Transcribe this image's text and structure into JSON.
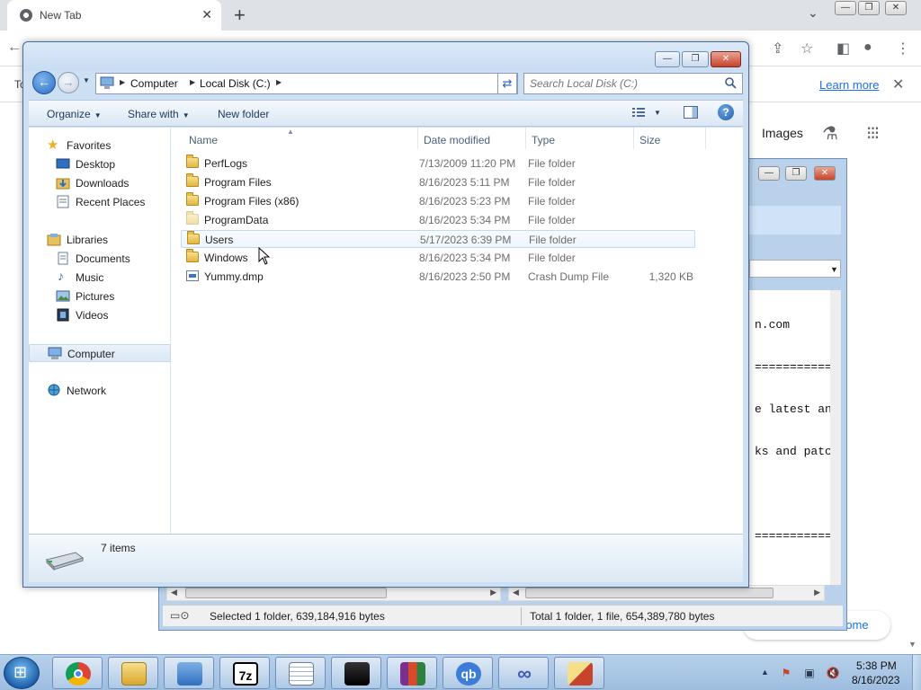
{
  "chrome": {
    "tab_title": "New Tab",
    "tab_close": "✕",
    "new_tab": "+",
    "tab_search": "⌄",
    "window_buttons": [
      "—",
      "❐",
      "✕"
    ],
    "infobar_text": "To",
    "infobar_link": "Learn more",
    "infobar_close": "✕",
    "images_link": "Images",
    "customize_label": "rome",
    "toolbar_icons": [
      "share-icon",
      "star-icon",
      "side-panel-icon",
      "profile-icon",
      "menu-icon"
    ]
  },
  "zip": {
    "window_buttons": [
      "—",
      "❐",
      "✕"
    ],
    "content_lines": [
      "n.com",
      "==============",
      "e latest an",
      "ks and patc",
      "",
      "==============",
      "",
      " :)",
      "",
      "=============="
    ],
    "status_selected": "Selected 1 folder, 639,184,916 bytes",
    "status_total": "Total 1 folder, 1 file, 654,389,780 bytes"
  },
  "explorer": {
    "window_buttons": [
      "—",
      "❐",
      "✕"
    ],
    "breadcrumb": [
      "Computer",
      "Local Disk (C:)"
    ],
    "search_placeholder": "Search Local Disk (C:)",
    "toolbar": {
      "organize": "Organize",
      "share_with": "Share with",
      "new_folder": "New folder"
    },
    "nav": {
      "favorites": "Favorites",
      "favorites_items": [
        "Desktop",
        "Downloads",
        "Recent Places"
      ],
      "libraries": "Libraries",
      "libraries_items": [
        "Documents",
        "Music",
        "Pictures",
        "Videos"
      ],
      "computer": "Computer",
      "network": "Network"
    },
    "columns": [
      "Name",
      "Date modified",
      "Type",
      "Size"
    ],
    "files": [
      {
        "name": "PerfLogs",
        "date": "7/13/2009 11:20 PM",
        "type": "File folder",
        "size": "",
        "kind": "folder"
      },
      {
        "name": "Program Files",
        "date": "8/16/2023 5:11 PM",
        "type": "File folder",
        "size": "",
        "kind": "folder"
      },
      {
        "name": "Program Files (x86)",
        "date": "8/16/2023 5:23 PM",
        "type": "File folder",
        "size": "",
        "kind": "folder"
      },
      {
        "name": "ProgramData",
        "date": "8/16/2023 5:34 PM",
        "type": "File folder",
        "size": "",
        "kind": "hidden-folder"
      },
      {
        "name": "Users",
        "date": "5/17/2023 6:39 PM",
        "type": "File folder",
        "size": "",
        "kind": "folder"
      },
      {
        "name": "Windows",
        "date": "8/16/2023 5:34 PM",
        "type": "File folder",
        "size": "",
        "kind": "folder"
      },
      {
        "name": "Yummy.dmp",
        "date": "8/16/2023 2:50 PM",
        "type": "Crash Dump File",
        "size": "1,320 KB",
        "kind": "dump"
      }
    ],
    "hovered_file": "Users",
    "item_count": "7 items"
  },
  "taskbar": {
    "apps": [
      "chrome-icon",
      "explorer-icon",
      "network-icon",
      "7zip-icon",
      "notepad-icon",
      "cat-app-icon",
      "winrar-icon",
      "qbittorrent-icon",
      "infinity-app-icon",
      "installer-icon"
    ],
    "app_glyphs": {
      "sevenzip": "7z",
      "qbittorrent": "qb"
    },
    "clock_time": "5:38 PM",
    "clock_date": "8/16/2023"
  },
  "colors": {
    "explorer_frame": "#cddff3",
    "chrome_link": "#1a73e8",
    "taskbar": "#b7d0ea",
    "close_red": "#c7432b"
  }
}
